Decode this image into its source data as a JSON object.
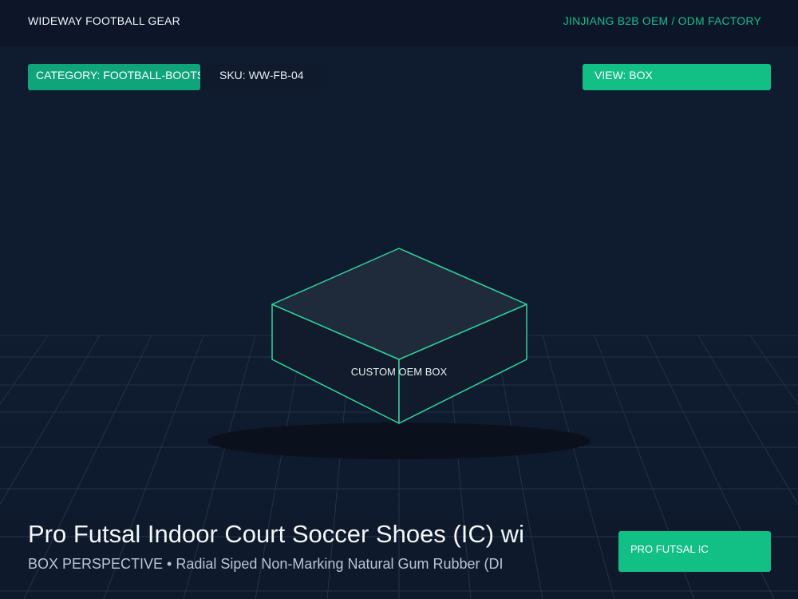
{
  "header": {
    "brand": "WIDEWAY FOOTBALL GEAR",
    "tagline": "JINJIANG B2B OEM / ODM FACTORY"
  },
  "chips": {
    "category": "CATEGORY: FOOTBALL-BOOTS",
    "sku": "SKU: WW-FB-04",
    "view": "VIEW: BOX"
  },
  "scene": {
    "box_label": "CUSTOM OEM BOX"
  },
  "product": {
    "title": "Pro Futsal Indoor Court Soccer Shoes (IC) wi",
    "subtitle": "BOX PERSPECTIVE • Radial Siped Non-Marking Natural Gum Rubber (DI",
    "badge": "PRO FUTSAL IC"
  },
  "colors": {
    "accent": "#12bf84",
    "background": "#0f1b2d",
    "box_outline": "#2fd39a"
  }
}
